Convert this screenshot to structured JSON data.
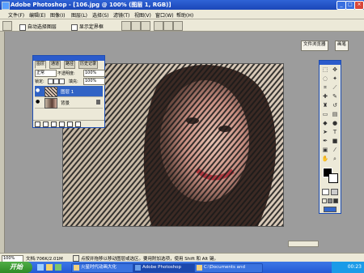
{
  "title_bar": {
    "title": "Adobe Photoshop - [106.jpg @ 100% (图层 1, RGB)]",
    "buttons": [
      "_",
      "□",
      "×"
    ]
  },
  "menu": {
    "items": [
      "文件(F)",
      "编辑(E)",
      "图像(I)",
      "图层(L)",
      "选择(S)",
      "滤镜(T)",
      "视图(V)",
      "窗口(W)",
      "帮助(H)"
    ]
  },
  "options_bar": {
    "auto_select_label": "自动选择图层",
    "show_bounds_label": "显示定界框"
  },
  "palette_well": {
    "tabs": [
      "文件浏览器",
      "画笔"
    ]
  },
  "layers_panel": {
    "tabs": [
      "图层",
      "通道",
      "路径",
      "历史记录"
    ],
    "blend_mode": "正常",
    "opacity_label": "不透明度:",
    "opacity_value": "100%",
    "lock_label": "锁定:",
    "fill_label": "填充:",
    "fill_value": "100%",
    "layers": [
      {
        "name": "图层 1",
        "selected": true
      },
      {
        "name": "背景",
        "selected": false
      }
    ]
  },
  "status_bar": {
    "zoom": "100%",
    "doc_size": "文档:706K/2.01M",
    "hint": "点按并拖移以移动图层或选区。要用附加选项，使用 Shift 和 Alt 键。"
  },
  "taskbar": {
    "start_label": "开始",
    "tasks": [
      {
        "label": "火星时代动画大化",
        "active": false
      },
      {
        "label": "Adobe Photoshop",
        "active": true
      },
      {
        "label": "C:\\Documents and",
        "active": false
      }
    ],
    "clock": "00:23"
  },
  "colors": {
    "title_blue": "#1b47b8",
    "panel_bg": "#ece9d8",
    "workspace_gray": "#9c9c9c",
    "selected_layer": "#3163c5"
  }
}
